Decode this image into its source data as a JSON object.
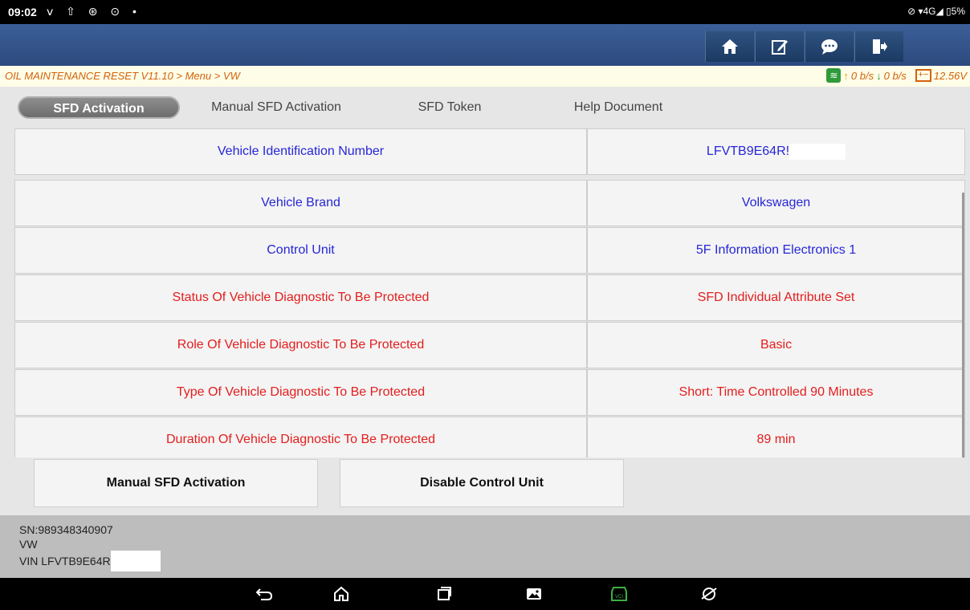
{
  "status_bar": {
    "time": "09:02",
    "icons_left": "ⅴ ⇧ ⊛ ⊙ •",
    "icons_right": "⊘ ▾4G◢ ▯5%"
  },
  "header": {
    "icons": [
      "home-icon",
      "edit-icon",
      "chat-icon",
      "exit-icon"
    ]
  },
  "breadcrumb": {
    "text": "OIL MAINTENANCE RESET V11.10 > Menu > VW",
    "up_rate": "0 b/s",
    "down_rate": "0 b/s",
    "voltage": "12.56V"
  },
  "tabs": [
    {
      "label": "SFD Activation"
    },
    {
      "label": "Manual SFD Activation"
    },
    {
      "label": "SFD Token"
    },
    {
      "label": "Help Document"
    }
  ],
  "rows": [
    {
      "label": "Vehicle Identification Number",
      "value": "LFVTB9E64R!",
      "color": "blue"
    },
    {
      "label": "Vehicle Brand",
      "value": "Volkswagen",
      "color": "blue"
    },
    {
      "label": "Control Unit",
      "value": "5F Information Electronics 1",
      "color": "blue"
    },
    {
      "label": "Status Of Vehicle Diagnostic To Be Protected",
      "value": "SFD Individual Attribute Set",
      "color": "red"
    },
    {
      "label": "Role Of Vehicle Diagnostic To Be Protected",
      "value": "Basic",
      "color": "red"
    },
    {
      "label": "Type Of Vehicle Diagnostic To Be Protected",
      "value": "Short: Time Controlled 90 Minutes",
      "color": "red"
    },
    {
      "label": "Duration Of Vehicle Diagnostic To Be Protected",
      "value": "89 min",
      "color": "red"
    }
  ],
  "actions": {
    "manual": "Manual SFD Activation",
    "disable": "Disable Control Unit"
  },
  "info": {
    "sn": "SN:989348340907",
    "brand": "VW",
    "vin": "VIN LFVTB9E64R"
  },
  "colors": {
    "blue_text": "#2626d8",
    "red_text": "#e41d1d",
    "header": "#2c4a7d",
    "crumb": "#d4620a"
  }
}
